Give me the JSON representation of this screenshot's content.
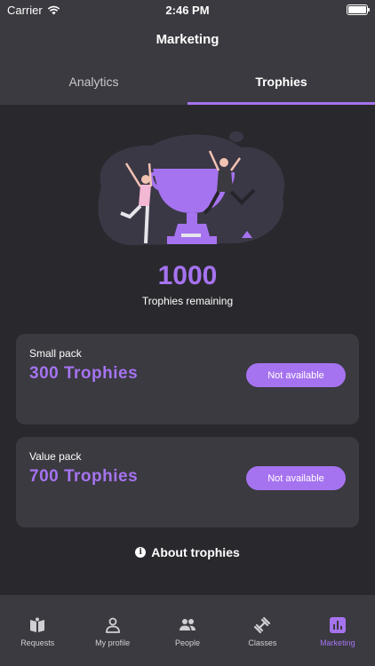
{
  "status_bar": {
    "carrier": "Carrier",
    "time": "2:46 PM"
  },
  "header": {
    "title": "Marketing"
  },
  "tabs": [
    {
      "label": "Analytics",
      "active": false
    },
    {
      "label": "Trophies",
      "active": true
    }
  ],
  "trophies": {
    "count": "1000",
    "label": "Trophies remaining"
  },
  "packs": [
    {
      "name": "Small pack",
      "amount": "300 Trophies",
      "button": "Not available"
    },
    {
      "name": "Value pack",
      "amount": "700 Trophies",
      "button": "Not available"
    }
  ],
  "about": {
    "label": "About trophies",
    "icon": "info-icon"
  },
  "tabbar": [
    {
      "label": "Requests",
      "icon": "book-icon",
      "active": false
    },
    {
      "label": "My profile",
      "icon": "person-icon",
      "active": false
    },
    {
      "label": "People",
      "icon": "people-icon",
      "active": false
    },
    {
      "label": "Classes",
      "icon": "dumbbell-icon",
      "active": false
    },
    {
      "label": "Marketing",
      "icon": "chart-icon",
      "active": true
    }
  ],
  "colors": {
    "accent": "#a673f0",
    "background": "#29282d",
    "surface": "#3a3a40"
  }
}
